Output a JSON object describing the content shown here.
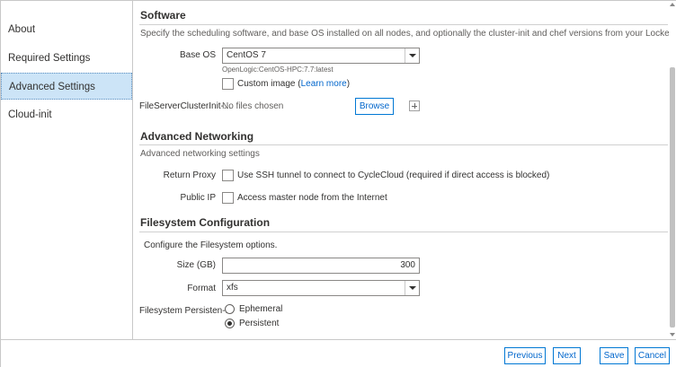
{
  "sidebar": {
    "items": [
      {
        "label": "About"
      },
      {
        "label": "Required Settings"
      },
      {
        "label": "Advanced Settings",
        "active": true
      },
      {
        "label": "Cloud-init"
      }
    ]
  },
  "software": {
    "title": "Software",
    "description": "Specify the scheduling software, and base OS installed on all nodes, and optionally the cluster-init and chef versions from your Locker.",
    "base_os_label": "Base OS",
    "base_os_value": "CentOS 7",
    "base_os_hint": "OpenLogic:CentOS-HPC:7.7:latest",
    "custom_image_label": "Custom image (",
    "learn_more": "Learn more",
    "custom_image_suffix": ")",
    "cluster_init_label": "FileServerClusterInit-...",
    "no_files": "No files chosen",
    "browse": "Browse"
  },
  "networking": {
    "title": "Advanced Networking",
    "description": "Advanced networking settings",
    "return_proxy_label": "Return Proxy",
    "return_proxy_text": "Use SSH tunnel to connect to CycleCloud (required if direct access is blocked)",
    "public_ip_label": "Public IP",
    "public_ip_text": "Access master node from the Internet"
  },
  "filesystem": {
    "title": "Filesystem Configuration",
    "description": "Configure the Filesystem options.",
    "size_label": "Size (GB)",
    "size_value": "300",
    "format_label": "Format",
    "format_value": "xfs",
    "persistence_label": "Filesystem Persisten-...",
    "option_ephemeral": "Ephemeral",
    "option_persistent": "Persistent",
    "selected": "Persistent"
  },
  "footer": {
    "previous": "Previous",
    "next": "Next",
    "save": "Save",
    "cancel": "Cancel"
  },
  "colors": {
    "accent": "#0078d4",
    "active_nav_bg": "#cce4f7",
    "link": "#0066cc"
  }
}
